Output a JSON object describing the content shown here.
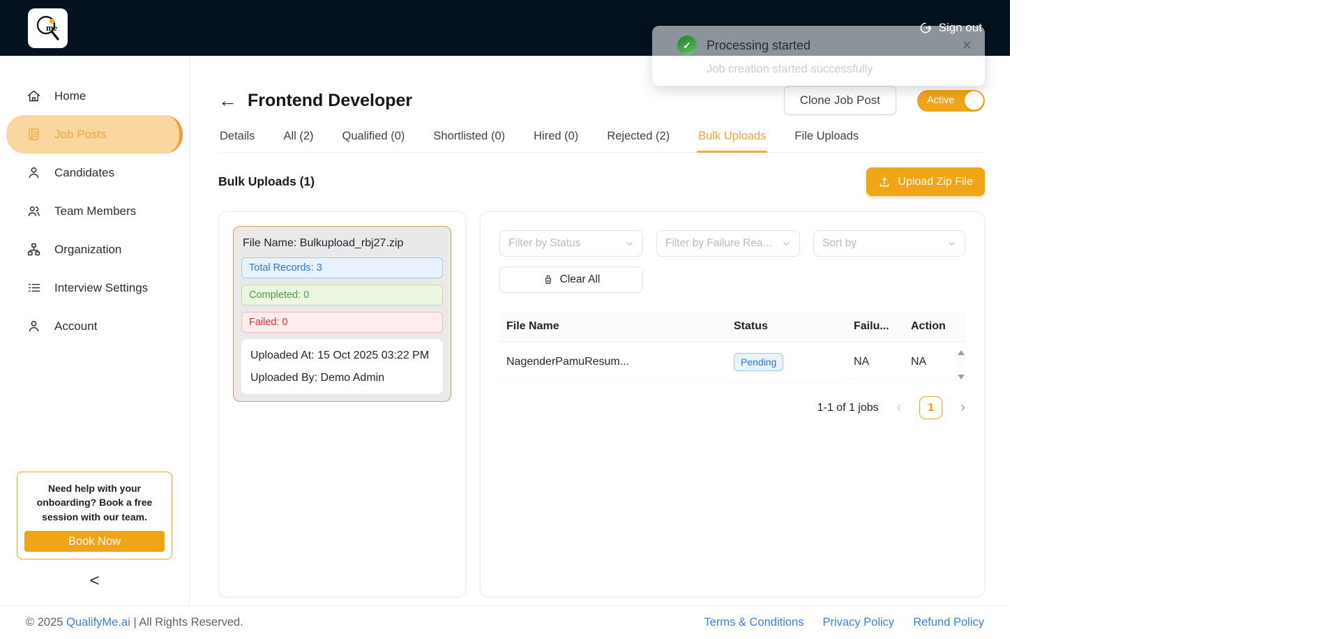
{
  "header": {
    "sign_out_label": "Sign out",
    "logo_text": "me"
  },
  "toast": {
    "check_icon": "✓",
    "title": "Processing started",
    "message": "Job creation started successfully",
    "close_icon": "✕"
  },
  "sidebar": {
    "items": [
      {
        "label": "Home",
        "icon": "home-icon"
      },
      {
        "label": "Job Posts",
        "icon": "job-posts-icon",
        "active": true
      },
      {
        "label": "Candidates",
        "icon": "person-icon"
      },
      {
        "label": "Team Members",
        "icon": "people-icon"
      },
      {
        "label": "Organization",
        "icon": "org-chart-icon"
      },
      {
        "label": "Interview Settings",
        "icon": "list-icon"
      },
      {
        "label": "Account",
        "icon": "person-icon"
      }
    ],
    "help": {
      "text": "Need help with your onboarding? Book a free session with our team.",
      "button_label": "Book Now"
    },
    "collapse_icon": "<"
  },
  "main": {
    "back_icon": "←",
    "title": "Frontend Developer",
    "clone_button_label": "Clone Job Post",
    "status_toggle_label": "Active",
    "tabs": [
      {
        "label": "Details"
      },
      {
        "label": "All (2)"
      },
      {
        "label": "Qualified (0)"
      },
      {
        "label": "Shortlisted (0)"
      },
      {
        "label": "Hired (0)"
      },
      {
        "label": "Rejected (2)"
      },
      {
        "label": "Bulk Uploads",
        "active": true
      },
      {
        "label": "File Uploads"
      }
    ],
    "section_title": "Bulk Uploads (1)",
    "upload_button_label": "Upload Zip File",
    "upload_card": {
      "file_name": "File Name: Bulkupload_rbj27.zip",
      "total_records": "Total Records: 3",
      "completed": "Completed: 0",
      "failed": "Failed: 0",
      "uploaded_at": "Uploaded At: 15 Oct 2025 03:22 PM",
      "uploaded_by": "Uploaded By: Demo Admin"
    },
    "filters": {
      "status_placeholder": "Filter by Status",
      "failure_placeholder": "Filter by Failure Rea...",
      "sort_placeholder": "Sort by",
      "clear_all_label": "Clear All"
    },
    "table": {
      "headers": [
        "File Name",
        "Status",
        "Failu...",
        "Action"
      ],
      "rows": [
        {
          "file_name": "NagenderPamuResum...",
          "status": "Pending",
          "failure": "NA",
          "action": "NA"
        }
      ]
    },
    "pagination": {
      "summary": "1-1 of 1 jobs",
      "prev_icon": "‹",
      "current_page": "1",
      "next_icon": "›"
    }
  },
  "footer": {
    "copyright_prefix": "© 2025 ",
    "brand": "QualifyMe.ai",
    "copyright_suffix": " | All Rights Reserved.",
    "links": [
      "Terms & Conditions",
      "Privacy Policy",
      "Refund Policy"
    ]
  },
  "colors": {
    "accent_orange": "#F0A517",
    "header_bg": "#04111F",
    "active_tab": "#EBA23C",
    "status_blue": "#2E74DA",
    "success_green": "#43A047",
    "fail_red": "#CD3636",
    "link_blue": "#3D7EE0"
  }
}
